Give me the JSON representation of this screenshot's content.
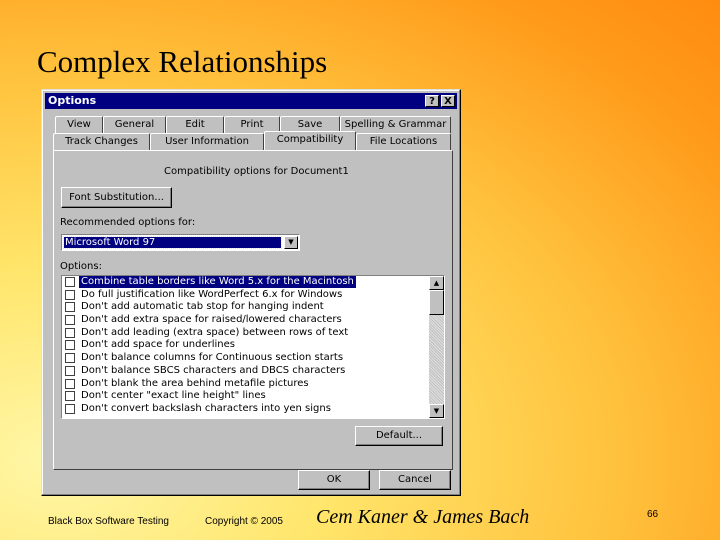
{
  "slide": {
    "title": "Complex Relationships",
    "footer_left": "Black Box Software Testing",
    "footer_copyright": "Copyright © 2005",
    "footer_authors": "Cem Kaner & James Bach",
    "page_number": "66"
  },
  "dialog": {
    "title": "Options",
    "help_button": "?",
    "close_button": "X",
    "tabs_row1": [
      "View",
      "General",
      "Edit",
      "Print",
      "Save",
      "Spelling & Grammar"
    ],
    "tabs_row2": [
      "Track Changes",
      "User Information",
      "Compatibility",
      "File Locations"
    ],
    "active_tab": "Compatibility",
    "heading": "Compatibility options for Document1",
    "font_sub_button": "Font Substitution...",
    "recommended_label": "Recommended options for:",
    "recommended_value": "Microsoft Word 97",
    "options_label": "Options:",
    "options": [
      "Combine table borders like Word 5.x for the Macintosh",
      "Do full justification like WordPerfect 6.x for Windows",
      "Don't add automatic tab stop for hanging indent",
      "Don't add extra space for raised/lowered characters",
      "Don't add leading (extra space) between rows of text",
      "Don't add space for underlines",
      "Don't balance columns for Continuous section starts",
      "Don't balance SBCS characters and DBCS characters",
      "Don't blank the area behind metafile pictures",
      "Don't center \"exact line height\" lines",
      "Don't convert backslash characters into yen signs"
    ],
    "selected_option_index": 0,
    "default_button": "Default...",
    "ok_button": "OK",
    "cancel_button": "Cancel"
  }
}
